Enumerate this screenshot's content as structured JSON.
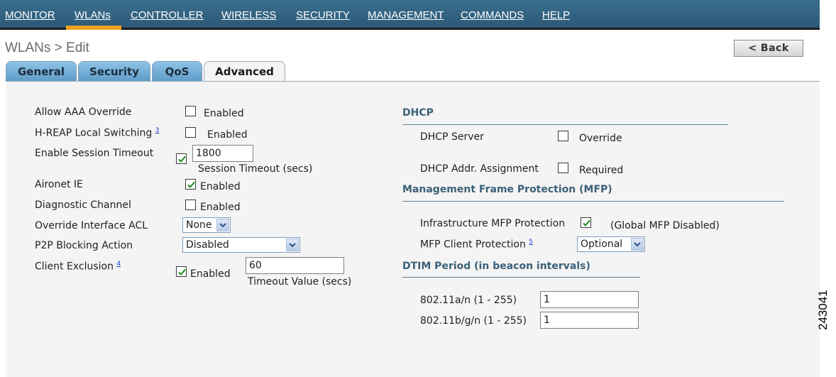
{
  "nav": {
    "items": [
      {
        "label": "MONITOR"
      },
      {
        "label": "WLANs"
      },
      {
        "label": "CONTROLLER"
      },
      {
        "label": "WIRELESS"
      },
      {
        "label": "SECURITY"
      },
      {
        "label": "MANAGEMENT"
      },
      {
        "label": "COMMANDS"
      },
      {
        "label": "HELP"
      }
    ],
    "active": "WLANs"
  },
  "page": {
    "title": "WLANs > Edit",
    "back_label": "< Back"
  },
  "tabs": [
    {
      "label": "General"
    },
    {
      "label": "Security"
    },
    {
      "label": "QoS"
    },
    {
      "label": "Advanced"
    }
  ],
  "left": {
    "aaa_override": {
      "label": "Allow AAA Override",
      "checked": false,
      "option": "Enabled"
    },
    "hreap": {
      "label": "H-REAP Local Switching",
      "footnote": "3",
      "checked": false,
      "option": "Enabled"
    },
    "session_timeout": {
      "label": "Enable Session Timeout",
      "checked": true,
      "value": "1800",
      "caption": "Session Timeout (secs)"
    },
    "aironet": {
      "label": "Aironet IE",
      "checked": true,
      "option": "Enabled"
    },
    "diagnostic": {
      "label": "Diagnostic Channel",
      "checked": false,
      "option": "Enabled"
    },
    "override_acl": {
      "label": "Override Interface ACL",
      "value": "None"
    },
    "p2p": {
      "label": "P2P Blocking Action",
      "value": "Disabled"
    },
    "client_exclusion": {
      "label": "Client Exclusion",
      "footnote": "4",
      "checked": true,
      "option": "Enabled",
      "value": "60",
      "caption": "Timeout Value (secs)"
    }
  },
  "right": {
    "dhcp": {
      "heading": "DHCP",
      "server": {
        "label": "DHCP Server",
        "checked": false,
        "option": "Override"
      },
      "assignment": {
        "label": "DHCP Addr. Assignment",
        "checked": false,
        "option": "Required"
      }
    },
    "mfp": {
      "heading": "Management Frame Protection (MFP)",
      "infra": {
        "label": "Infrastructure MFP Protection",
        "checked": true,
        "note": "(Global MFP Disabled)"
      },
      "client": {
        "label": "MFP Client Protection",
        "footnote": "5",
        "value": "Optional"
      }
    },
    "dtim": {
      "heading": "DTIM Period (in beacon intervals)",
      "a": {
        "label": "802.11a/n (1 - 255)",
        "value": "1"
      },
      "bg": {
        "label": "802.11b/g/n (1 - 255)",
        "value": "1"
      }
    }
  },
  "figure_id": "243041",
  "icons": {
    "check": "check-icon",
    "dropdown": "chevron-down-icon"
  },
  "colors": {
    "nav_bg": "#2f607f",
    "active_underline": "#f0a020",
    "heading": "#3c6078"
  }
}
